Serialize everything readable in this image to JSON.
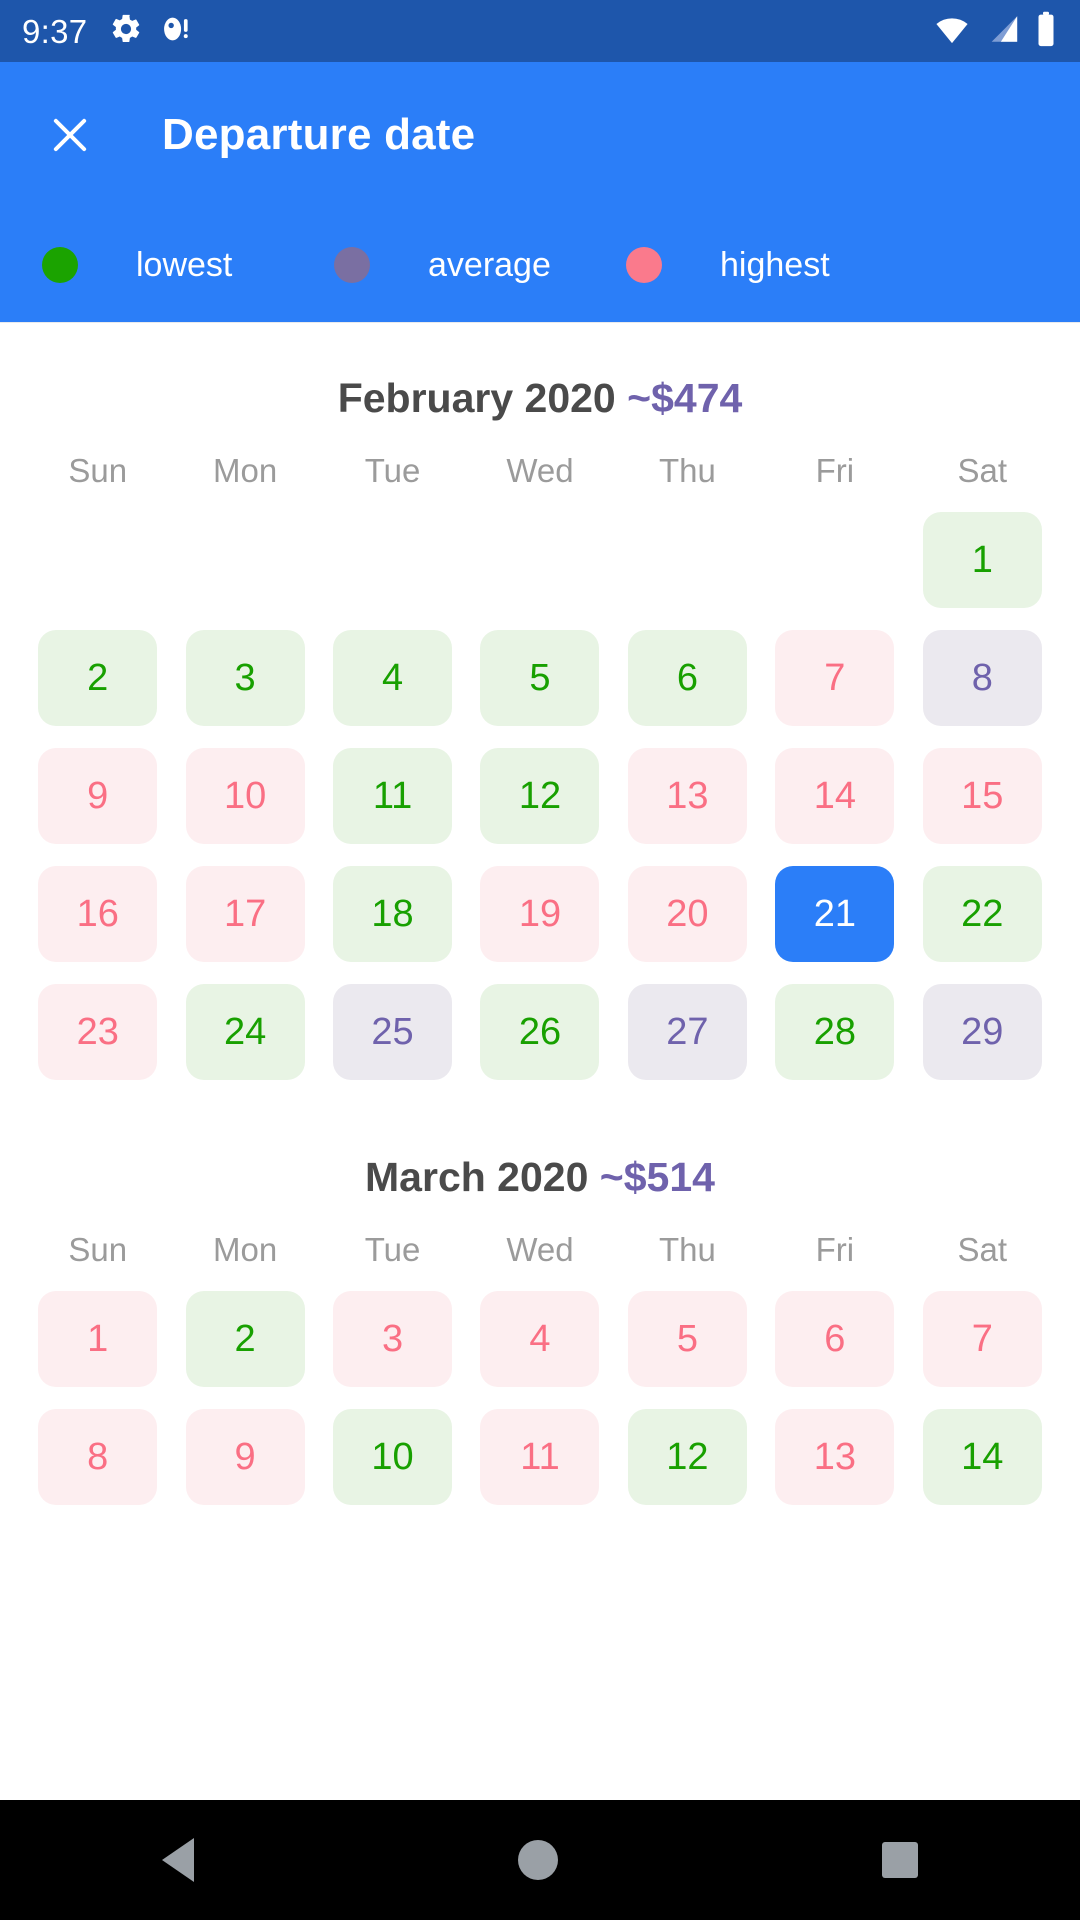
{
  "status_bar": {
    "time": "9:37",
    "icons_left": [
      "gear-icon",
      "bug-droid-icon"
    ],
    "icons_right": [
      "wifi-icon",
      "cell-signal-icon",
      "battery-icon"
    ],
    "background_color": "#1e56ab"
  },
  "app_bar": {
    "close_icon": "close-icon",
    "title": "Departure date",
    "background_color": "#2b7ef8",
    "legend": [
      {
        "label": "lowest",
        "color": "#1ba300"
      },
      {
        "label": "average",
        "color": "#7a6fa2"
      },
      {
        "label": "highest",
        "color": "#fa7a8c"
      }
    ]
  },
  "weekday_headers": [
    "Sun",
    "Mon",
    "Tue",
    "Wed",
    "Thu",
    "Fri",
    "Sat"
  ],
  "colors": {
    "low_bg": "#e8f4e4",
    "low_fg": "#18a000",
    "high_bg": "#fdeef0",
    "high_fg": "#fa6f84",
    "avg_bg": "#ebe9ef",
    "avg_fg": "#6f62ac",
    "selected_bg": "#2b7ef8",
    "selected_fg": "#ffffff",
    "month_title": "#4a4a4a",
    "month_price": "#6f62ac"
  },
  "months": [
    {
      "name": "February 2020",
      "price": "~$474",
      "weeks": [
        [
          {
            "day": "",
            "level": "empty"
          },
          {
            "day": "",
            "level": "empty"
          },
          {
            "day": "",
            "level": "empty"
          },
          {
            "day": "",
            "level": "empty"
          },
          {
            "day": "",
            "level": "empty"
          },
          {
            "day": "",
            "level": "empty"
          },
          {
            "day": "1",
            "level": "low"
          }
        ],
        [
          {
            "day": "2",
            "level": "low"
          },
          {
            "day": "3",
            "level": "low"
          },
          {
            "day": "4",
            "level": "low"
          },
          {
            "day": "5",
            "level": "low"
          },
          {
            "day": "6",
            "level": "low"
          },
          {
            "day": "7",
            "level": "high"
          },
          {
            "day": "8",
            "level": "avg"
          }
        ],
        [
          {
            "day": "9",
            "level": "high"
          },
          {
            "day": "10",
            "level": "high"
          },
          {
            "day": "11",
            "level": "low"
          },
          {
            "day": "12",
            "level": "low"
          },
          {
            "day": "13",
            "level": "high"
          },
          {
            "day": "14",
            "level": "high"
          },
          {
            "day": "15",
            "level": "high"
          }
        ],
        [
          {
            "day": "16",
            "level": "high"
          },
          {
            "day": "17",
            "level": "high"
          },
          {
            "day": "18",
            "level": "low"
          },
          {
            "day": "19",
            "level": "high"
          },
          {
            "day": "20",
            "level": "high"
          },
          {
            "day": "21",
            "level": "selected"
          },
          {
            "day": "22",
            "level": "low"
          }
        ],
        [
          {
            "day": "23",
            "level": "high"
          },
          {
            "day": "24",
            "level": "low"
          },
          {
            "day": "25",
            "level": "avg"
          },
          {
            "day": "26",
            "level": "low"
          },
          {
            "day": "27",
            "level": "avg"
          },
          {
            "day": "28",
            "level": "low"
          },
          {
            "day": "29",
            "level": "avg"
          }
        ]
      ]
    },
    {
      "name": "March 2020",
      "price": "~$514",
      "weeks": [
        [
          {
            "day": "1",
            "level": "high"
          },
          {
            "day": "2",
            "level": "low"
          },
          {
            "day": "3",
            "level": "high"
          },
          {
            "day": "4",
            "level": "high"
          },
          {
            "day": "5",
            "level": "high"
          },
          {
            "day": "6",
            "level": "high"
          },
          {
            "day": "7",
            "level": "high"
          }
        ],
        [
          {
            "day": "8",
            "level": "high"
          },
          {
            "day": "9",
            "level": "high"
          },
          {
            "day": "10",
            "level": "low"
          },
          {
            "day": "11",
            "level": "high"
          },
          {
            "day": "12",
            "level": "low"
          },
          {
            "day": "13",
            "level": "high"
          },
          {
            "day": "14",
            "level": "low"
          }
        ]
      ]
    }
  ],
  "nav_bar": {
    "items": [
      "back-icon",
      "home-icon",
      "recents-icon"
    ],
    "background_color": "#000000"
  }
}
